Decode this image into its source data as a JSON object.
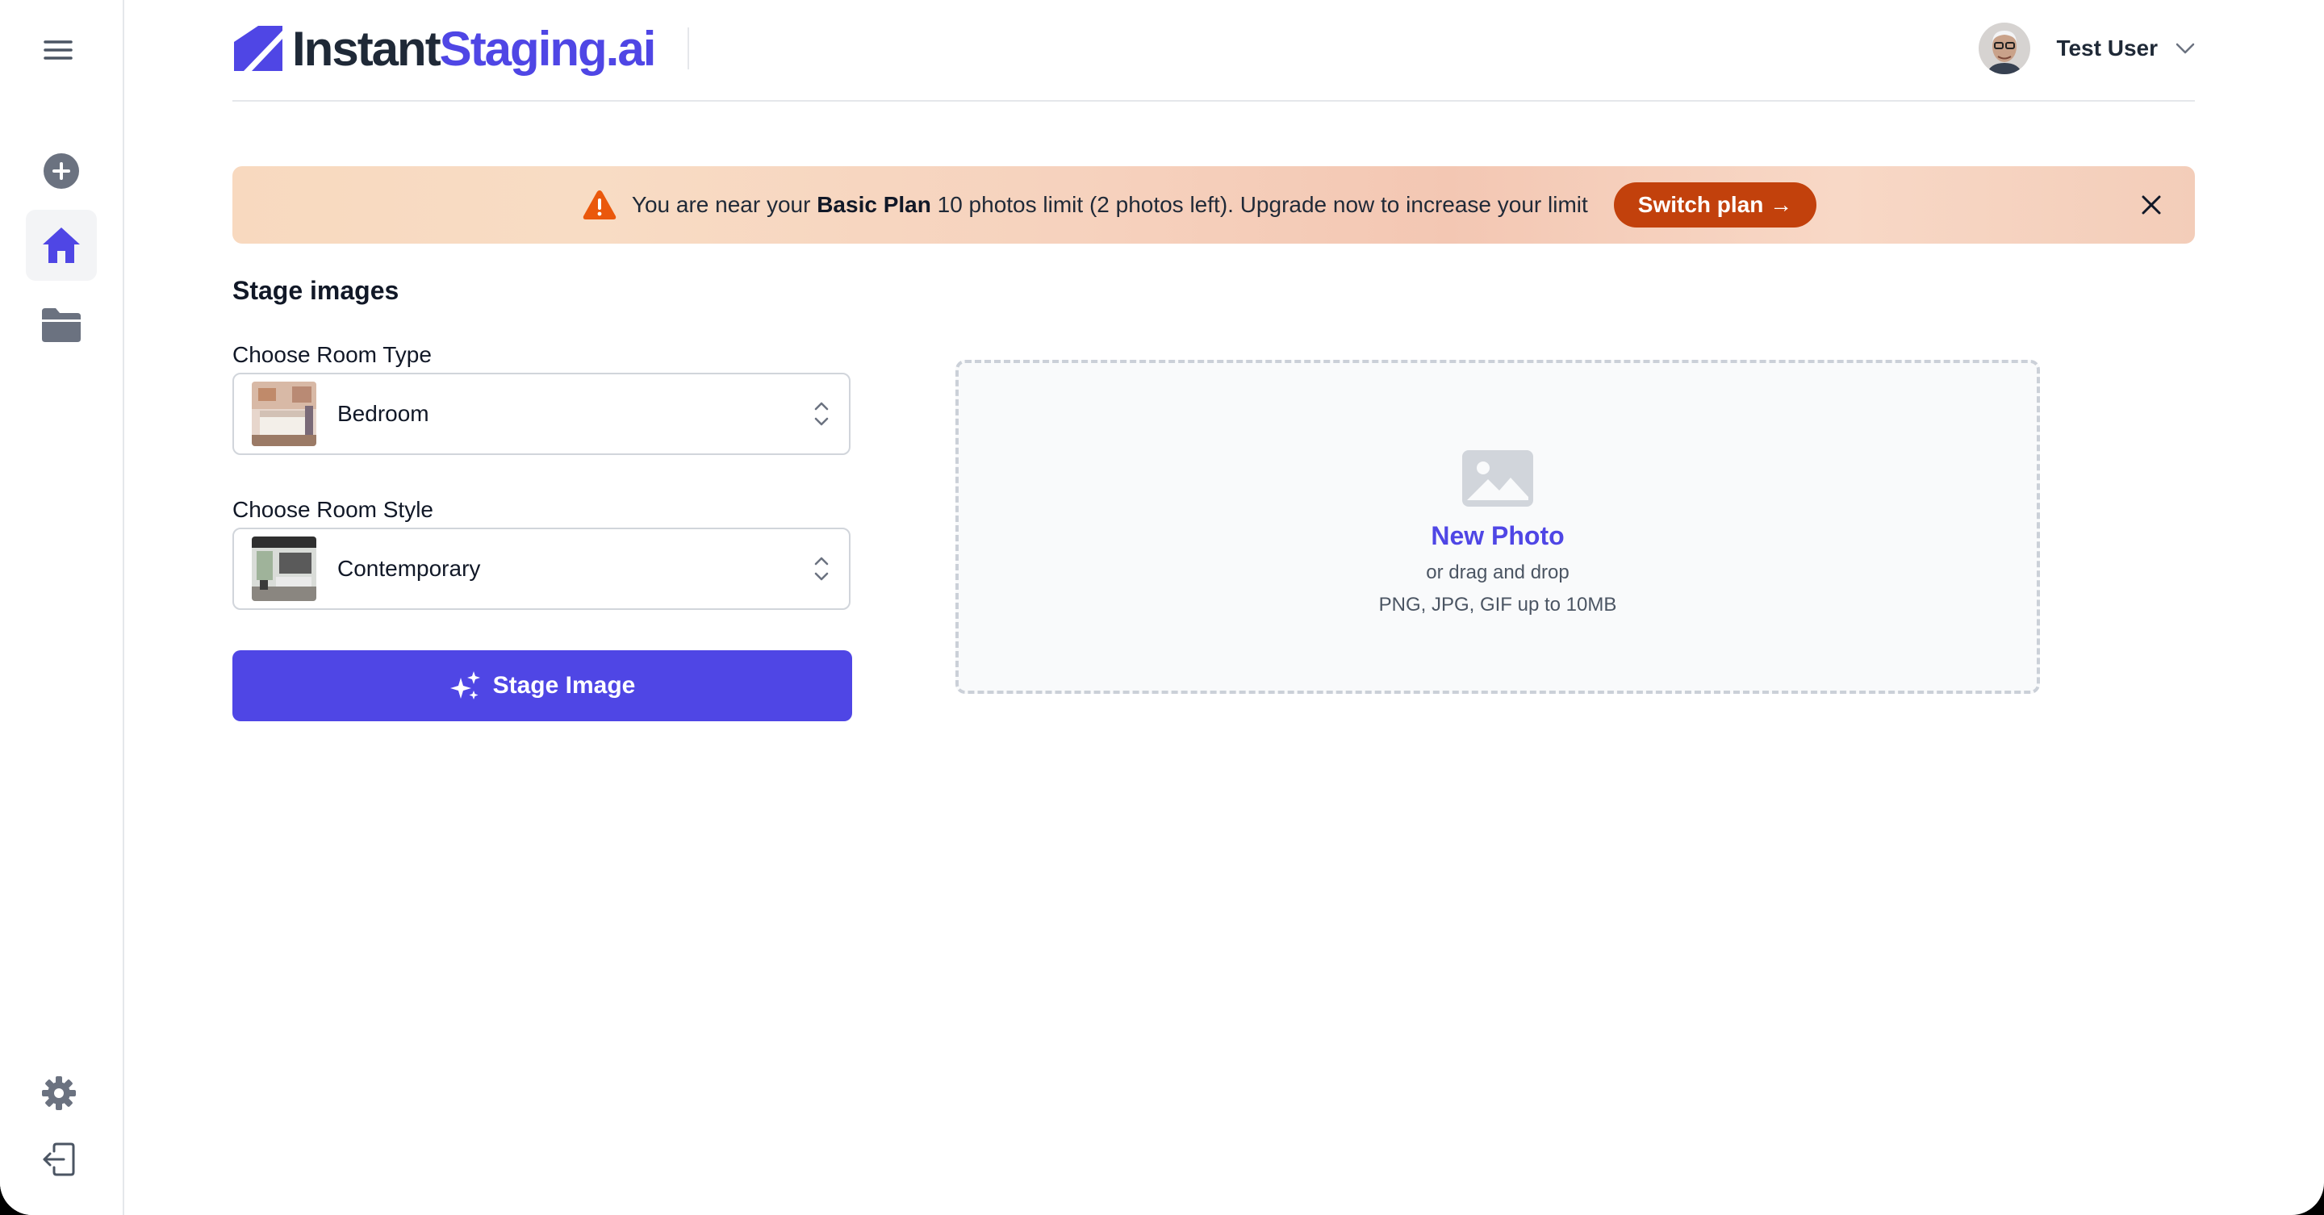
{
  "header": {
    "logo_part1": "Instant",
    "logo_part2": "Staging.ai",
    "user_name": "Test User"
  },
  "banner": {
    "text_before": "You are near your ",
    "plan_name": "Basic Plan",
    "text_after": " 10 photos limit (2 photos left). Upgrade now to increase your limit",
    "switch_label": "Switch plan →"
  },
  "form": {
    "section_title": "Stage images",
    "room_type_label": "Choose Room Type",
    "room_type_value": "Bedroom",
    "room_style_label": "Choose Room Style",
    "room_style_value": "Contemporary",
    "stage_button": "Stage Image"
  },
  "upload": {
    "title": "New Photo",
    "subtitle": "or drag and drop",
    "types": "PNG, JPG, GIF up to 10MB"
  },
  "colors": {
    "accent": "#4f46e5",
    "warning": "#c2410c"
  }
}
